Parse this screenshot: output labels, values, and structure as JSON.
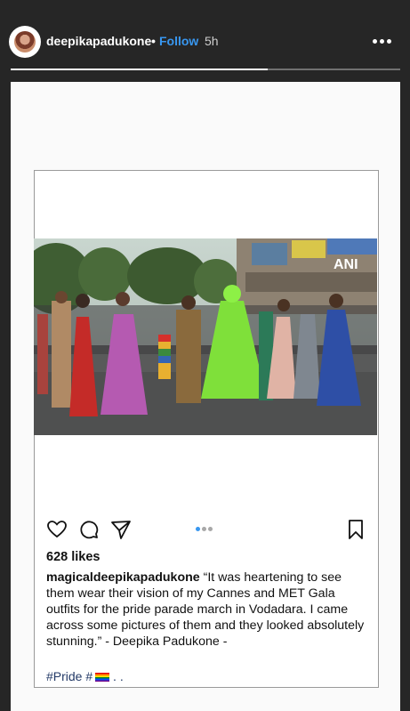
{
  "header": {
    "username": "deepikapadukone",
    "separator": "•",
    "follow_label": "Follow",
    "time": "5h",
    "avatar_icon": "profile-avatar",
    "more_icon": "more-options-icon",
    "story_progress": 0.66
  },
  "post": {
    "watermark": "ANI",
    "carousel": {
      "count": 3,
      "active": 0
    },
    "icons": [
      "heart-icon",
      "comment-icon",
      "share-icon",
      "bookmark-icon"
    ],
    "likes": "628 likes",
    "caption_user": "magicaldeepikapadukone",
    "caption_text": " “It was heartening to see them wear their vision of my Cannes and MET Gala outfits for the pride parade march in Vodadara. I came across some pictures of them and they looked absolutely stunning.” - Deepika Padukone -",
    "tags_text": "#Pride #",
    "tags_suffix": " . ."
  },
  "colors": {
    "background": "#262626",
    "link": "#3897f0",
    "card": "#fafafa",
    "hashtag": "#233a67"
  }
}
